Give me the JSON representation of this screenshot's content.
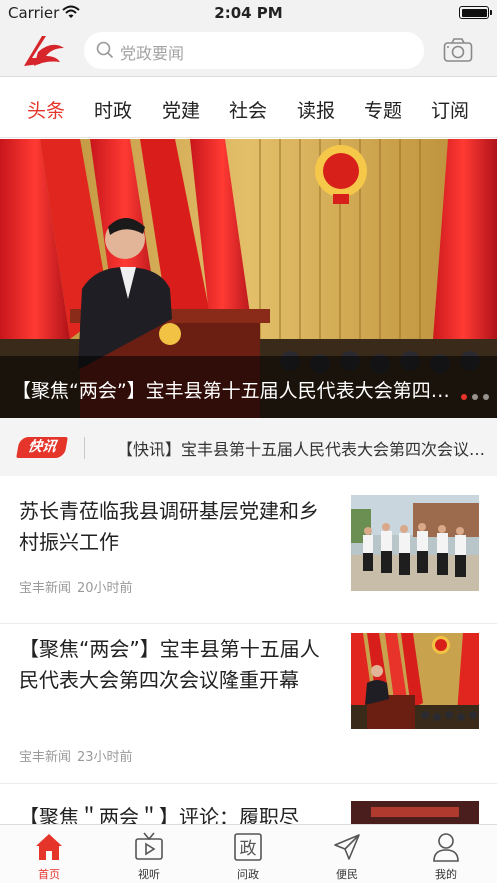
{
  "status_bar": {
    "carrier": "Carrier",
    "time": "2:04 PM"
  },
  "header": {
    "search_placeholder": "党政要闻",
    "logo_icon": "app-logo-icon",
    "camera_icon": "camera-icon",
    "accent_color": "#e5352b"
  },
  "tabs": [
    {
      "label": "头条",
      "active": true
    },
    {
      "label": "时政",
      "active": false
    },
    {
      "label": "党建",
      "active": false
    },
    {
      "label": "社会",
      "active": false
    },
    {
      "label": "读报",
      "active": false
    },
    {
      "label": "专题",
      "active": false
    },
    {
      "label": "订阅",
      "active": false
    }
  ],
  "hero": {
    "caption": "【聚焦“两会”】宝丰县第十五届人民代表大会第四次会议隆重开幕",
    "slide_count": 3,
    "active_slide": 1
  },
  "ticker": {
    "badge": "快讯",
    "text": "【快讯】宝丰县第十五届人民代表大会第四次会议隆重开幕"
  },
  "news": [
    {
      "title": "苏长青莅临我县调研基层党建和乡村振兴工作",
      "source": "宝丰新闻",
      "time": "20小时前"
    },
    {
      "title": "【聚焦“两会”】宝丰县第十五届人民代表大会第四次会议隆重开幕",
      "source": "宝丰新闻",
      "time": "23小时前"
    },
    {
      "title": "【聚焦＂两会＂】评论：履职尽",
      "source": "",
      "time": ""
    }
  ],
  "tabbar": [
    {
      "label": "首页",
      "icon": "home-icon",
      "active": true
    },
    {
      "label": "视听",
      "icon": "tv-icon",
      "active": false
    },
    {
      "label": "问政",
      "icon": "zheng-icon",
      "active": false,
      "glyph": "政"
    },
    {
      "label": "便民",
      "icon": "send-icon",
      "active": false
    },
    {
      "label": "我的",
      "icon": "user-icon",
      "active": false
    }
  ]
}
